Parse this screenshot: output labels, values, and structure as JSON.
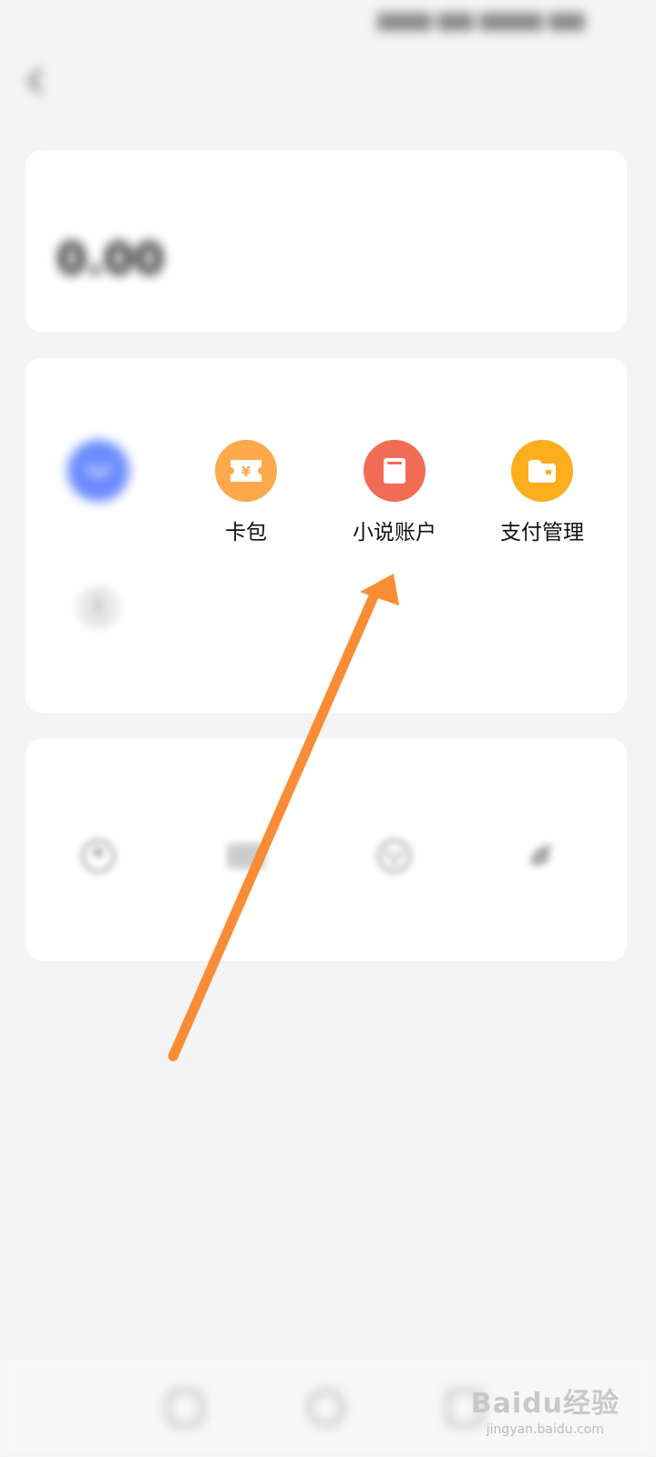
{
  "status_bar": {
    "time": "",
    "indicators": ""
  },
  "header": {
    "title": ""
  },
  "balance": {
    "label": "",
    "value": "0.00"
  },
  "account_section": {
    "title": "",
    "items": [
      {
        "label": "",
        "icon": "smile-icon",
        "color": "#6b8cff"
      },
      {
        "label": "卡包",
        "icon": "yen-ticket-icon",
        "color": "#ffa94d"
      },
      {
        "label": "小说账户",
        "icon": "book-icon",
        "color": "#f26b55"
      },
      {
        "label": "支付管理",
        "icon": "wallet-icon",
        "color": "#fcae1e"
      },
      {
        "label": "",
        "icon": "user-icon",
        "color": "#bbbbbb"
      }
    ]
  },
  "third_party_section": {
    "title": "",
    "items": [
      {
        "label": "",
        "icon": "user-icon"
      },
      {
        "label": "",
        "icon": "card-icon"
      },
      {
        "label": "",
        "icon": "game-icon"
      },
      {
        "label": "",
        "icon": "dolphin-icon"
      }
    ]
  },
  "watermark": {
    "logo": "Baidu经验",
    "url": "jingyan.baidu.com"
  },
  "colors": {
    "arrow": "#fa8c35"
  }
}
